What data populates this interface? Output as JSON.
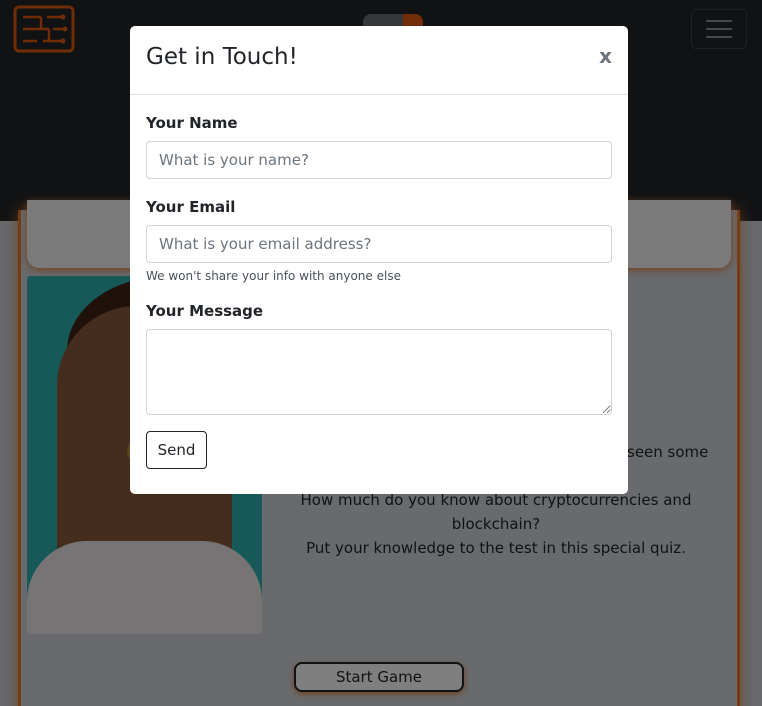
{
  "colors": {
    "navbar": "#212529",
    "accent_orange": "#e9782b",
    "modal_bg": "#ffffff",
    "backdrop": "rgba(0,0,0,0.5)"
  },
  "background": {
    "logo_icon": "circuit-board-icon",
    "menu_icon": "hamburger-menu-icon",
    "peek_text": "seen some",
    "body_lines": [
      "How much do you know about cryptocurrencies and",
      "blockchain?",
      "Put your knowledge to the test in this special quiz."
    ],
    "start_button": "Start Game"
  },
  "modal": {
    "title": "Get in Touch!",
    "close_label": "x",
    "name_label": "Your Name",
    "name_placeholder": "What is your name?",
    "email_label": "Your Email",
    "email_placeholder": "What is your email address?",
    "email_help": "We won't share your info with anyone else",
    "message_label": "Your Message",
    "message_value": "",
    "send_label": "Send"
  }
}
